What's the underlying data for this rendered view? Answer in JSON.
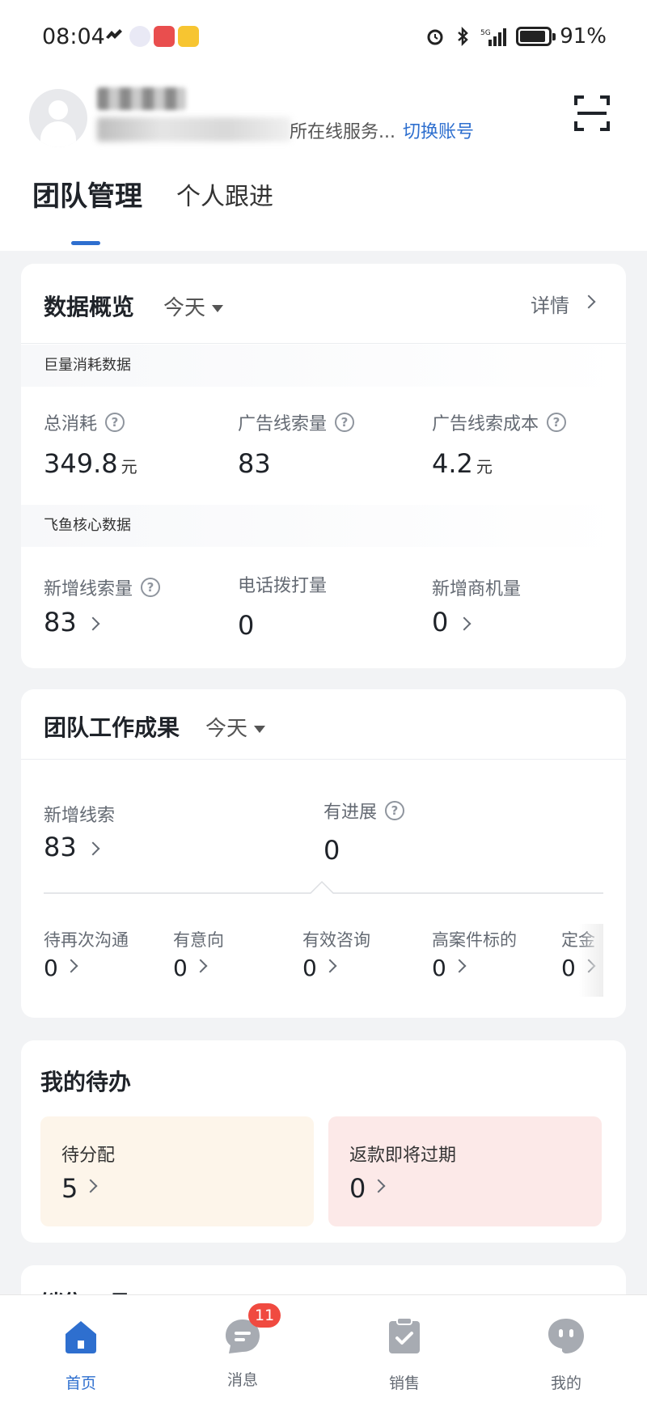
{
  "status_bar": {
    "time": "08:04",
    "battery": "91%"
  },
  "header": {
    "sub_visible": "所在线服务...",
    "switch_account": "切换账号"
  },
  "tabs": {
    "team": "团队管理",
    "personal": "个人跟进"
  },
  "overview": {
    "title": "数据概览",
    "period": "今天",
    "detail": "详情",
    "section_ads": "巨量消耗数据",
    "metrics_ads": [
      {
        "label": "总消耗",
        "value": "349.8",
        "unit": "元"
      },
      {
        "label": "广告线索量",
        "value": "83",
        "unit": ""
      },
      {
        "label": "广告线索成本",
        "value": "4.2",
        "unit": "元"
      }
    ],
    "section_core": "飞鱼核心数据",
    "metrics_core": [
      {
        "label": "新增线索量",
        "value": "83"
      },
      {
        "label": "电话拨打量",
        "value": "0"
      },
      {
        "label": "新增商机量",
        "value": "0"
      }
    ]
  },
  "team_results": {
    "title": "团队工作成果",
    "period": "今天",
    "new_leads_label": "新增线索",
    "new_leads_value": "83",
    "progress_label": "有进展",
    "progress_value": "0",
    "stages": [
      {
        "label": "待再次沟通",
        "value": "0"
      },
      {
        "label": "有意向",
        "value": "0"
      },
      {
        "label": "有效咨询",
        "value": "0"
      },
      {
        "label": "高案件标的",
        "value": "0"
      },
      {
        "label": "定金",
        "value": "0"
      }
    ]
  },
  "todo": {
    "title": "我的待办",
    "items": [
      {
        "label": "待分配",
        "value": "5"
      },
      {
        "label": "返款即将过期",
        "value": "0"
      }
    ]
  },
  "sales_tools": {
    "title": "销售工具"
  },
  "bottom_nav": {
    "items": [
      {
        "label": "首页",
        "icon": "home-icon"
      },
      {
        "label": "消息",
        "icon": "message-icon",
        "badge": "11"
      },
      {
        "label": "销售",
        "icon": "clipboard-check-icon"
      },
      {
        "label": "我的",
        "icon": "profile-icon"
      }
    ]
  },
  "colors": {
    "accent": "#2e6fcf",
    "badge": "#f04a40",
    "todo_orange": "#fdf5ea",
    "todo_red": "#fce9e8"
  }
}
